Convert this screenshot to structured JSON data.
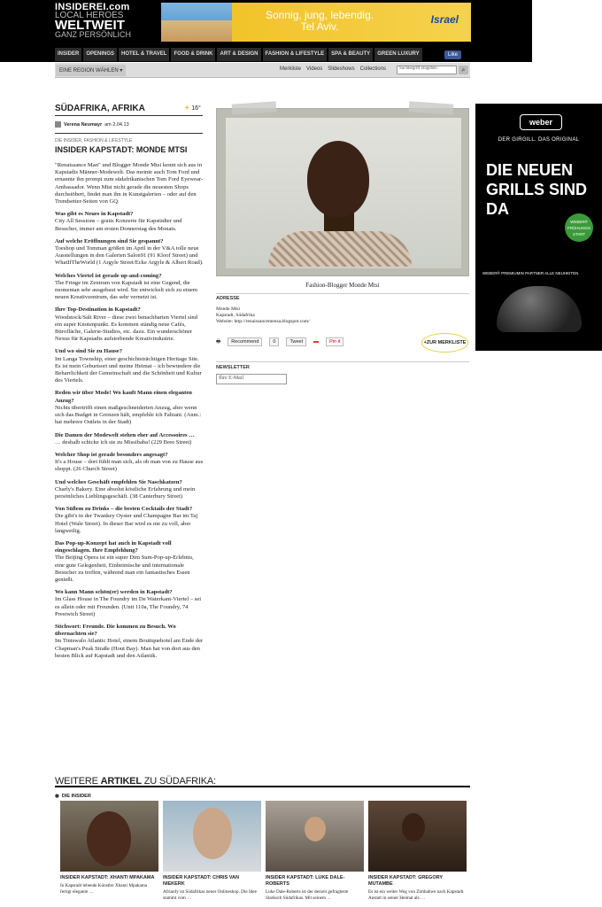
{
  "header": {
    "logo": {
      "line1": "INSIDEREI.com",
      "line2": "LOCAL HEROES",
      "line3": "WELTWEIT",
      "line4": "GANZ PERSÖNLICH"
    },
    "banner": {
      "slogan1": "Sonnig, jung, lebendig.",
      "slogan2": "Tel Aviv.",
      "brand": "Israel"
    },
    "nav": [
      "INSIDER",
      "OPENINGS",
      "HOTEL & TRAVEL",
      "FOOD & DRINK",
      "ART & DESIGN",
      "FASHION & LIFESTYLE",
      "SPA & BEAUTY",
      "GREEN LUXURY"
    ],
    "fb_like": "Like"
  },
  "subbar": {
    "region": "EINE REGION WÄHLEN ▾",
    "links": [
      "Merkliste",
      "Videos",
      "Slideshows",
      "Collections"
    ],
    "search_placeholder": "Suchbegriff eingeben"
  },
  "article": {
    "place": "SÜDAFRIKA, AFRIKA",
    "temperature": "16°",
    "author": "Verena Neumayr",
    "date": "am 2.04.13",
    "category": "DIE INSIDER, FASHION & LIFESTYLE",
    "title": "INSIDER KAPSTADT: MONDE MTSI",
    "paragraphs": [
      {
        "q": "",
        "a": "\"Renaissance Man\" und Blogger Monde Mtsi kennt sich aus in Kapstadts Männer-Modewelt. Das meinte auch Tom Ford und ernannte ihn prompt zum südafrikanischen Tom Ford Eyewear-Ambassador. Wenn Mtsi nicht gerade die neuesten Shops durchstöbert, findet man ihn in Kunstgalerien – oder auf den Trendsetter-Seiten von GQ."
      },
      {
        "q": "Was gibt es Neues in Kapstadt?",
        "a": "City All Sessions – gratis Konzerte für Kapstädter und Besucher, immer am ersten Donnerstag des Monats."
      },
      {
        "q": "Auf welche Eröffnungen sind Sie gespannt?",
        "a": "Toeshop und Tomman größen im April in der V&A tolle neue Ausstellungen in den Galerien Salon91 (91 Kloof Street) und WhatIfTheWorld (1 Argyle Street/Ecke Argyle & Albert Road)."
      },
      {
        "q": "Welches Viertel ist gerade up-and-coming?",
        "a": "The Fringe im Zentrum von Kapstadt ist eine Gegend, die momentan sehr ausgebaut wird. Sie entwickelt sich zu einem neuen Kreativzentrum, das sehr vernetzt ist."
      },
      {
        "q": "Ihre Top-Destination in Kapstadt?",
        "a": "Woodstock/Salt River – diese zwei benachbarten Viertel sind ein super Knotenpunkt. Es kommen ständig neue Cafés, Bürofläche, Galerie-Studios, etc. dazu. Ein wunderschöner Nexus für Kapstadts aufstrebende Kreativindustrie."
      },
      {
        "q": "Und wo sind Sie zu Hause?",
        "a": "Im Langa Township, einer geschichtsträchtigen Heritage Site. Es ist mein Geburtsort und meine Heimat – ich bewundere die Beharrlichkeit der Gemeinschaft und die Schönheit und Kultur des Viertels."
      },
      {
        "q": "Reden wir über Mode! Wo kauft Mann einen eleganten Anzug?",
        "a": "Nichts übertrifft einen maßgeschneiderten Anzug, aber wenn sich das Budget in Grenzen hält, empfehle ich Fabiani. (Anm.: hat mehrere Outlets in der Stadt)"
      },
      {
        "q": "Die Damen der Modewelt stehen eher auf Accessoires …",
        "a": "… deshalb schicke ich sie zu Missibaba! (229 Bree Street)"
      },
      {
        "q": "Welcher Shop ist gerade besonders angesagt?",
        "a": "It's a House – dort fühlt man sich, als ob man von zu Hause aus shoppt. (26 Church Street)"
      },
      {
        "q": "Und welches Geschäft empfehlen Sie Naschkatzen?",
        "a": "Charly's Bakery. Eine absolut köstliche Erfahrung und mein persönliches Lieblingsgeschäft. (38 Canterbury Street)"
      },
      {
        "q": "Von Süßem zu Drinks – die besten Cocktails der Stadt?",
        "a": "Die gibt's in der Twankey Oyster und Champagne Bar im Taj Hotel (Wale Street). In dieser Bar wird es nie zu voll, aber langweilig."
      },
      {
        "q": "Das Pop-up-Konzept hat auch in Kapstadt voll eingeschlagen. Ihre Empfehlung?",
        "a": "The Beijing Opera ist ein super Dim Sum-Pop-up-Erlebnis, eine gute Gelegenheit, Einheimische und internationale Besucher zu treffen, während man ein fantastisches Essen genießt."
      },
      {
        "q": "Wo kann Mann schön(er) werden in Kapstadt?",
        "a": "Im Glass House in The Foundry im De Waterkant-Viertel – sei es allein oder mit Freunden. (Unit 110a, The Foundry, 74 Prestwich Street)"
      },
      {
        "q": "Stichwort: Freunde. Die kommen zu Besuch. Wo übernachten sie?",
        "a": "Im Tintswalo Atlantic Hotel, einem Boutiquehotel am Ende der Chapman's Peak Straße (Hout Bay). Man hat von dort aus den besten Blick auf Kapstadt und den Atlantik."
      }
    ]
  },
  "sidebar": {
    "caption": "Fashion-Blogger Monde Mtsi",
    "address_label": "ADRESSE",
    "address_lines": [
      "Monde Mtsi",
      "Kapstadt, Südafrika",
      "Website: http://renaissancemensa.blogspot.com/"
    ],
    "share": {
      "recommend": "Recommend",
      "recommend_count": "0",
      "tweet": "Tweet",
      "gplus": "+1",
      "pin": "Pin it",
      "merkliste": "+ZUR MERKLISTE"
    },
    "newsletter_label": "NEWSLETTER",
    "email_placeholder": "Ihre E-Mail"
  },
  "ad": {
    "logo": "weber",
    "sub": "DER GIRGILL. DAS ORIGINAL",
    "headline": "DIE NEUEN GRILLS SIND DA",
    "badge": "WEBER® FRÜHLINGS START",
    "partner": "WEBER® PREMIUMIN PARTNER ALLE NEUHEITEN"
  },
  "more": {
    "heading_prefix": "WEITERE ",
    "heading_mid": "ARTIKEL",
    "heading_suffix": " ZU SÜDAFRIKA:",
    "section": "DIE INSIDER",
    "items": [
      {
        "title": "INSIDER KAPSTADT: XHANTI MPAKAMA",
        "desc": "In Kapstadt lebende Künstler Xhanti Mpakama fertigt elegante …"
      },
      {
        "title": "INSIDER KAPSTADT: CHRIS VAN NIEKERK",
        "desc": "Afrianfy ist Südafrikas neuer Onlineshop. Die Idee stammt vom …"
      },
      {
        "title": "INSIDER KAPSTADT: LUKE DALE-ROBERTS",
        "desc": "Luke Dale-Roberts ist der derzeit gefragteste Starkoch Südafrikas. Mit seinem …"
      },
      {
        "title": "INSIDER KAPSTADT: GREGORY MUTAMBE",
        "desc": "Es ist ein weiter Weg von Zimbabwe nach Kapstadt. Anstatt in seiner Heimat als …"
      }
    ]
  }
}
